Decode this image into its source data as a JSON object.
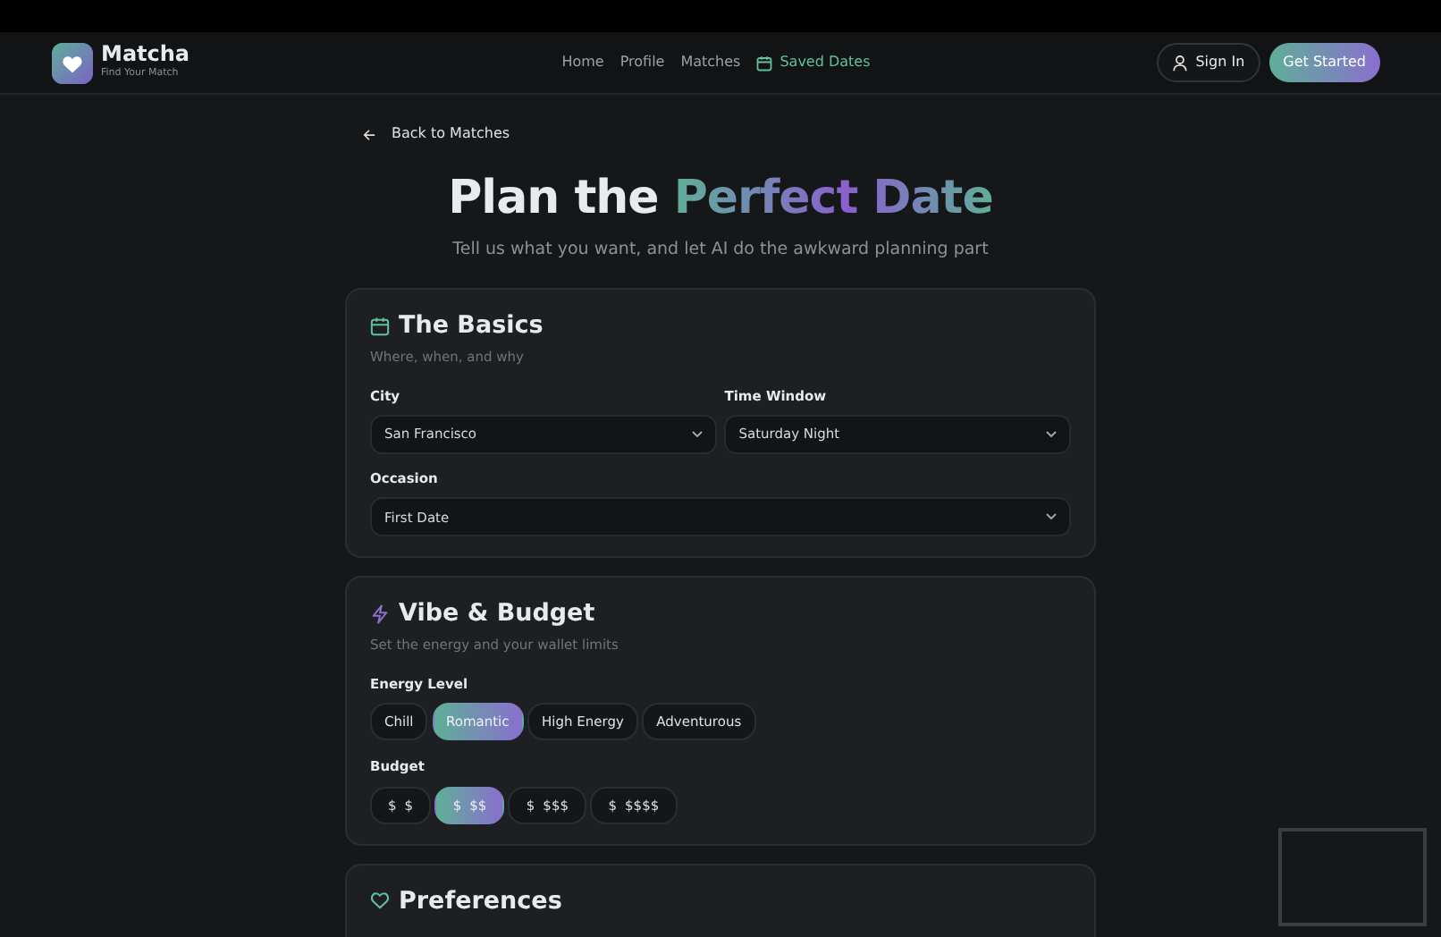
{
  "brand": {
    "name": "Matcha",
    "tagline": "Find Your Match"
  },
  "nav": [
    {
      "label": "Home",
      "selected": false,
      "kind": "text"
    },
    {
      "label": "Profile",
      "selected": false,
      "kind": "text"
    },
    {
      "label": "Matches",
      "selected": false,
      "kind": "text"
    },
    {
      "label": "Saved Dates",
      "selected": true,
      "kind": "calendar"
    }
  ],
  "sign_in": "Sign In",
  "get_started": "Get Started",
  "back_link": "Back to Matches",
  "title": {
    "plain": "Plan the",
    "highlight": "Perfect Date"
  },
  "subtitle": "Tell us what you want, and let AI do the awkward planning part",
  "basics": {
    "title": "The Basics",
    "subtitle": "Where, when, and why",
    "fields": [
      {
        "label": "City",
        "value": "San Francisco",
        "kind": "half"
      },
      {
        "label": "Time Window",
        "value": "Saturday Night",
        "kind": "half"
      },
      {
        "label": "Occasion",
        "value": "First Date",
        "kind": "full"
      }
    ]
  },
  "vibe": {
    "title": "Vibe & Budget",
    "subtitle": "Set the energy and your wallet limits",
    "energy_label": "Energy Level",
    "energy": [
      {
        "label": "Chill",
        "selected": false
      },
      {
        "label": "Romantic",
        "selected": true
      },
      {
        "label": "High Energy",
        "selected": false
      },
      {
        "label": "Adventurous",
        "selected": false
      }
    ],
    "budget_label": "Budget",
    "budget": [
      {
        "icon": "$",
        "label": "$",
        "selected": false
      },
      {
        "icon": "$",
        "label": "$$",
        "selected": true
      },
      {
        "icon": "$",
        "label": "$$$",
        "selected": false
      },
      {
        "icon": "$",
        "label": "$$$$",
        "selected": false
      }
    ]
  },
  "preferences": {
    "title": "Preferences"
  }
}
